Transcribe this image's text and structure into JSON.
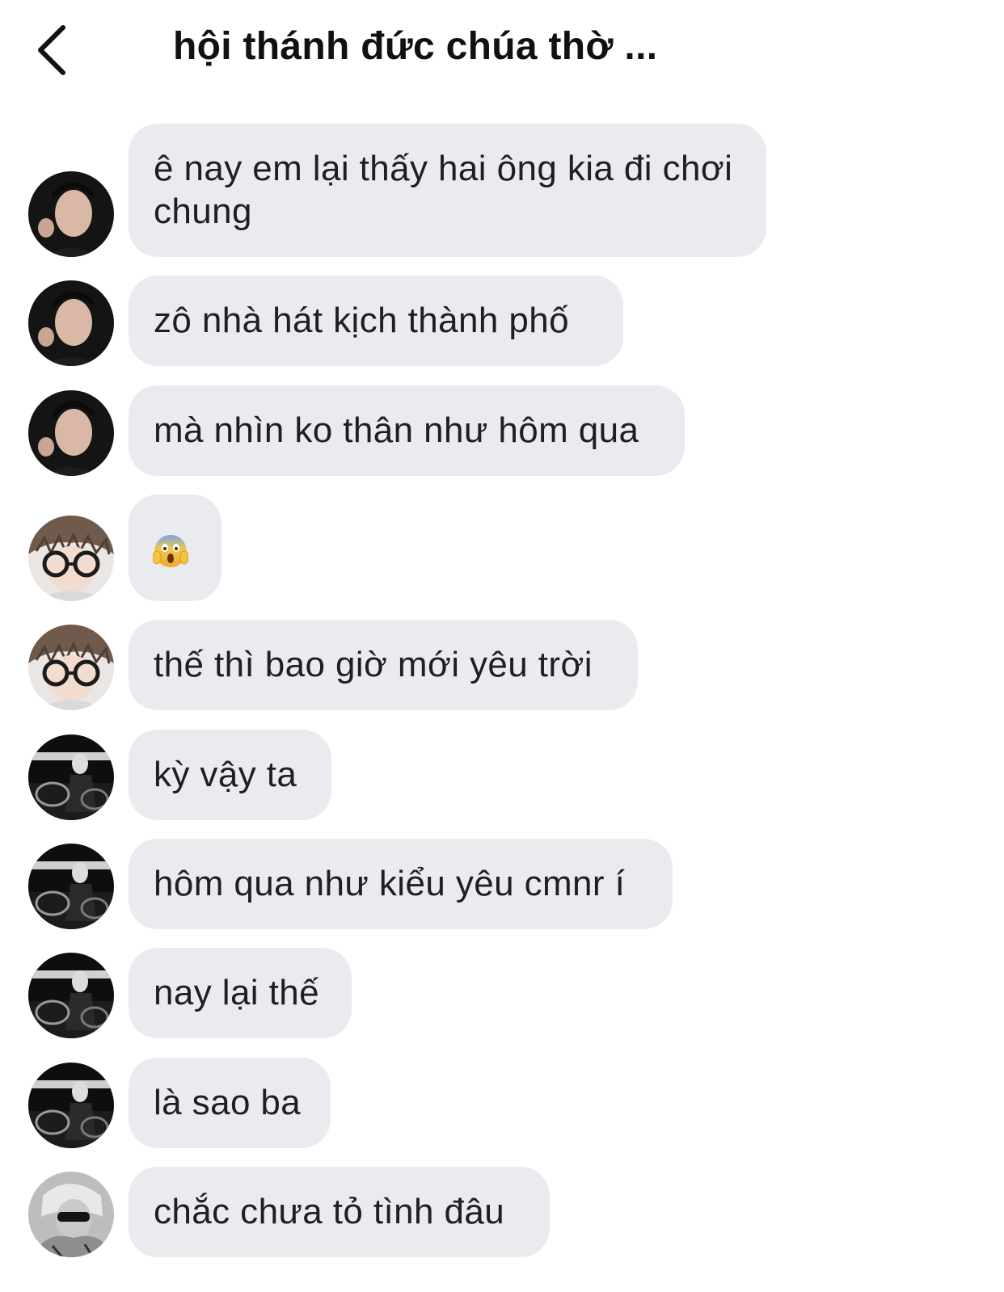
{
  "header": {
    "title": "hội thánh đức chúa thờ ...",
    "back_icon": "chevron-left-icon"
  },
  "messages": [
    {
      "sender": "avatar-a",
      "text": "ê nay em lại thấy hai ông kia đi chơi chung"
    },
    {
      "sender": "avatar-a",
      "text": "zô nhà hát kịch thành phố"
    },
    {
      "sender": "avatar-a",
      "text": "mà nhìn ko thân như hôm qua"
    },
    {
      "sender": "avatar-b",
      "emoji": "face-screaming-in-fear-icon"
    },
    {
      "sender": "avatar-b",
      "text": "thế thì bao giờ mới yêu trời"
    },
    {
      "sender": "avatar-c",
      "text": "kỳ vậy ta"
    },
    {
      "sender": "avatar-c",
      "text": "hôm qua như kiểu yêu cmnr í"
    },
    {
      "sender": "avatar-c",
      "text": "nay lại thế"
    },
    {
      "sender": "avatar-c",
      "text": "là sao ba"
    },
    {
      "sender": "avatar-d",
      "text": "chắc chưa tỏ tình đâu"
    }
  ],
  "colors": {
    "bubble_bg": "#e9ebef",
    "text": "#1f1f21",
    "background": "#ffffff"
  }
}
